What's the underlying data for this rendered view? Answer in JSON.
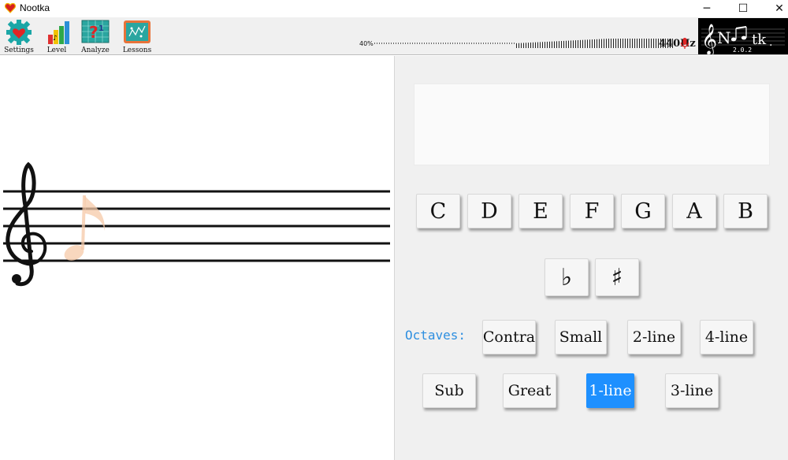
{
  "window": {
    "title": "Nootka",
    "minimize": "─",
    "maximize": "☐",
    "close": "✕"
  },
  "toolbar": {
    "items": [
      {
        "label": "Settings",
        "icon": "settings-icon"
      },
      {
        "label": "Level",
        "icon": "level-icon"
      },
      {
        "label": "Analyze",
        "icon": "analyze-icon"
      },
      {
        "label": "Lessons",
        "icon": "lessons-icon"
      }
    ],
    "frequency": "440Hz",
    "volume_label": "40%",
    "volume_level": 0.4,
    "logo_version": "2.0.2"
  },
  "staff": {
    "clef": "treble-clef",
    "note_hint": "eighth-note"
  },
  "answer": {
    "text": ""
  },
  "notes": [
    "C",
    "D",
    "E",
    "F",
    "G",
    "A",
    "B"
  ],
  "accidentals": {
    "flat": "♭",
    "sharp": "♯"
  },
  "octaves": {
    "label": "Octaves:",
    "row1": [
      "Contra",
      "Small",
      "2-line",
      "4-line"
    ],
    "row2": [
      "Sub",
      "Great",
      "1-line",
      "3-line"
    ],
    "selected": "1-line"
  },
  "colors": {
    "accent": "#1e90ff",
    "octave_label": "#2e8fe0",
    "note_hint": "#f6c9a8"
  }
}
